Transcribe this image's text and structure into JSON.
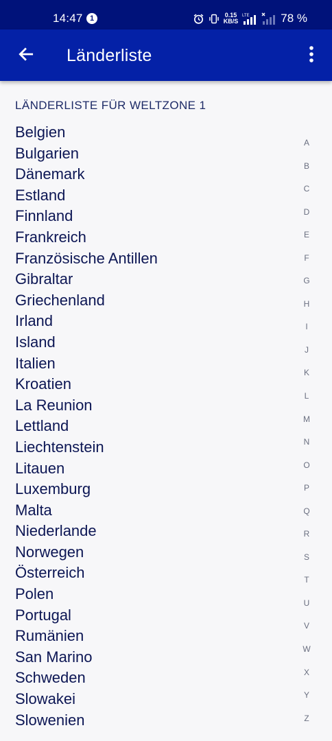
{
  "status_bar": {
    "time": "14:47",
    "notification_count": "1",
    "net_speed_value": "0.15",
    "net_speed_unit": "KB/S",
    "network_label": "LTE",
    "battery": "78 %"
  },
  "app_bar": {
    "title": "Länderliste"
  },
  "section": {
    "header": "LÄNDERLISTE FÜR WELTZONE 1"
  },
  "countries": [
    "Belgien",
    "Bulgarien",
    "Dänemark",
    "Estland",
    "Finnland",
    "Frankreich",
    "Französische Antillen",
    "Gibraltar",
    "Griechenland",
    "Irland",
    "Island",
    "Italien",
    "Kroatien",
    "La Reunion",
    "Lettland",
    "Liechtenstein",
    "Litauen",
    "Luxemburg",
    "Malta",
    "Niederlande",
    "Norwegen",
    "Österreich",
    "Polen",
    "Portugal",
    "Rumänien",
    "San Marino",
    "Schweden",
    "Slowakei",
    "Slowenien"
  ],
  "alphabet_index": [
    "A",
    "B",
    "C",
    "D",
    "E",
    "F",
    "G",
    "H",
    "I",
    "J",
    "K",
    "L",
    "M",
    "N",
    "O",
    "P",
    "Q",
    "R",
    "S",
    "T",
    "U",
    "V",
    "W",
    "X",
    "Y",
    "Z"
  ],
  "colors": {
    "status_bar": "#00127a",
    "app_bar": "#0421a7",
    "background": "#f7f7f9",
    "list_text": "#0c1654"
  },
  "icons": {
    "back": "arrow-left-icon",
    "menu": "more-vert-icon",
    "alarm": "alarm-icon",
    "vibrate": "vibrate-icon",
    "signal": "signal-icon",
    "notification_badge": "notification-badge"
  }
}
